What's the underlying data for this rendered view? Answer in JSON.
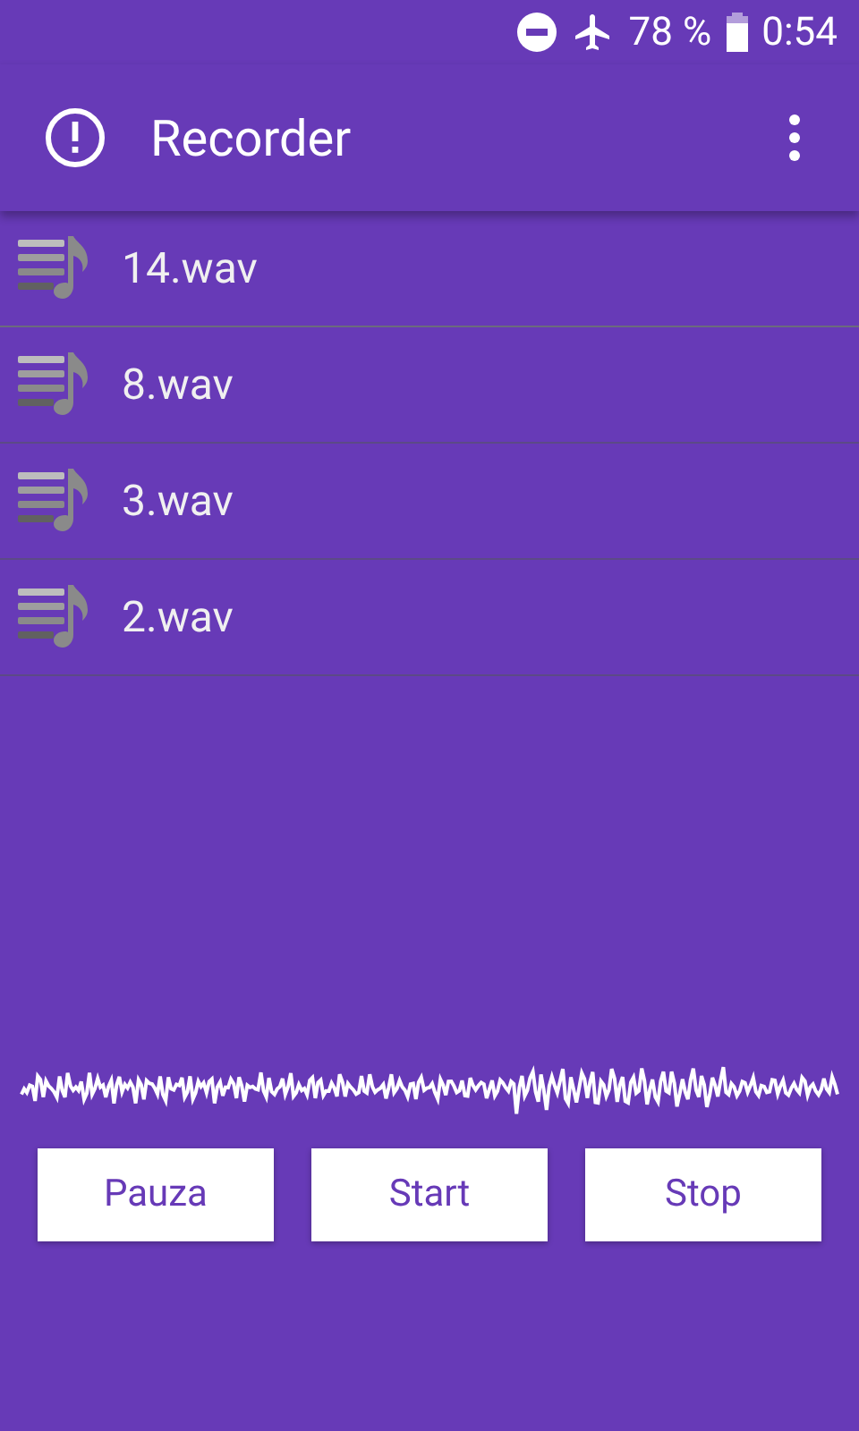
{
  "status_bar": {
    "battery": "78 %",
    "time": "0:54"
  },
  "app_bar": {
    "title": "Recorder"
  },
  "recordings": [
    {
      "name": "14.wav"
    },
    {
      "name": "8.wav"
    },
    {
      "name": "3.wav"
    },
    {
      "name": "2.wav"
    }
  ],
  "buttons": [
    "Pauza",
    "Start",
    "Stop"
  ]
}
